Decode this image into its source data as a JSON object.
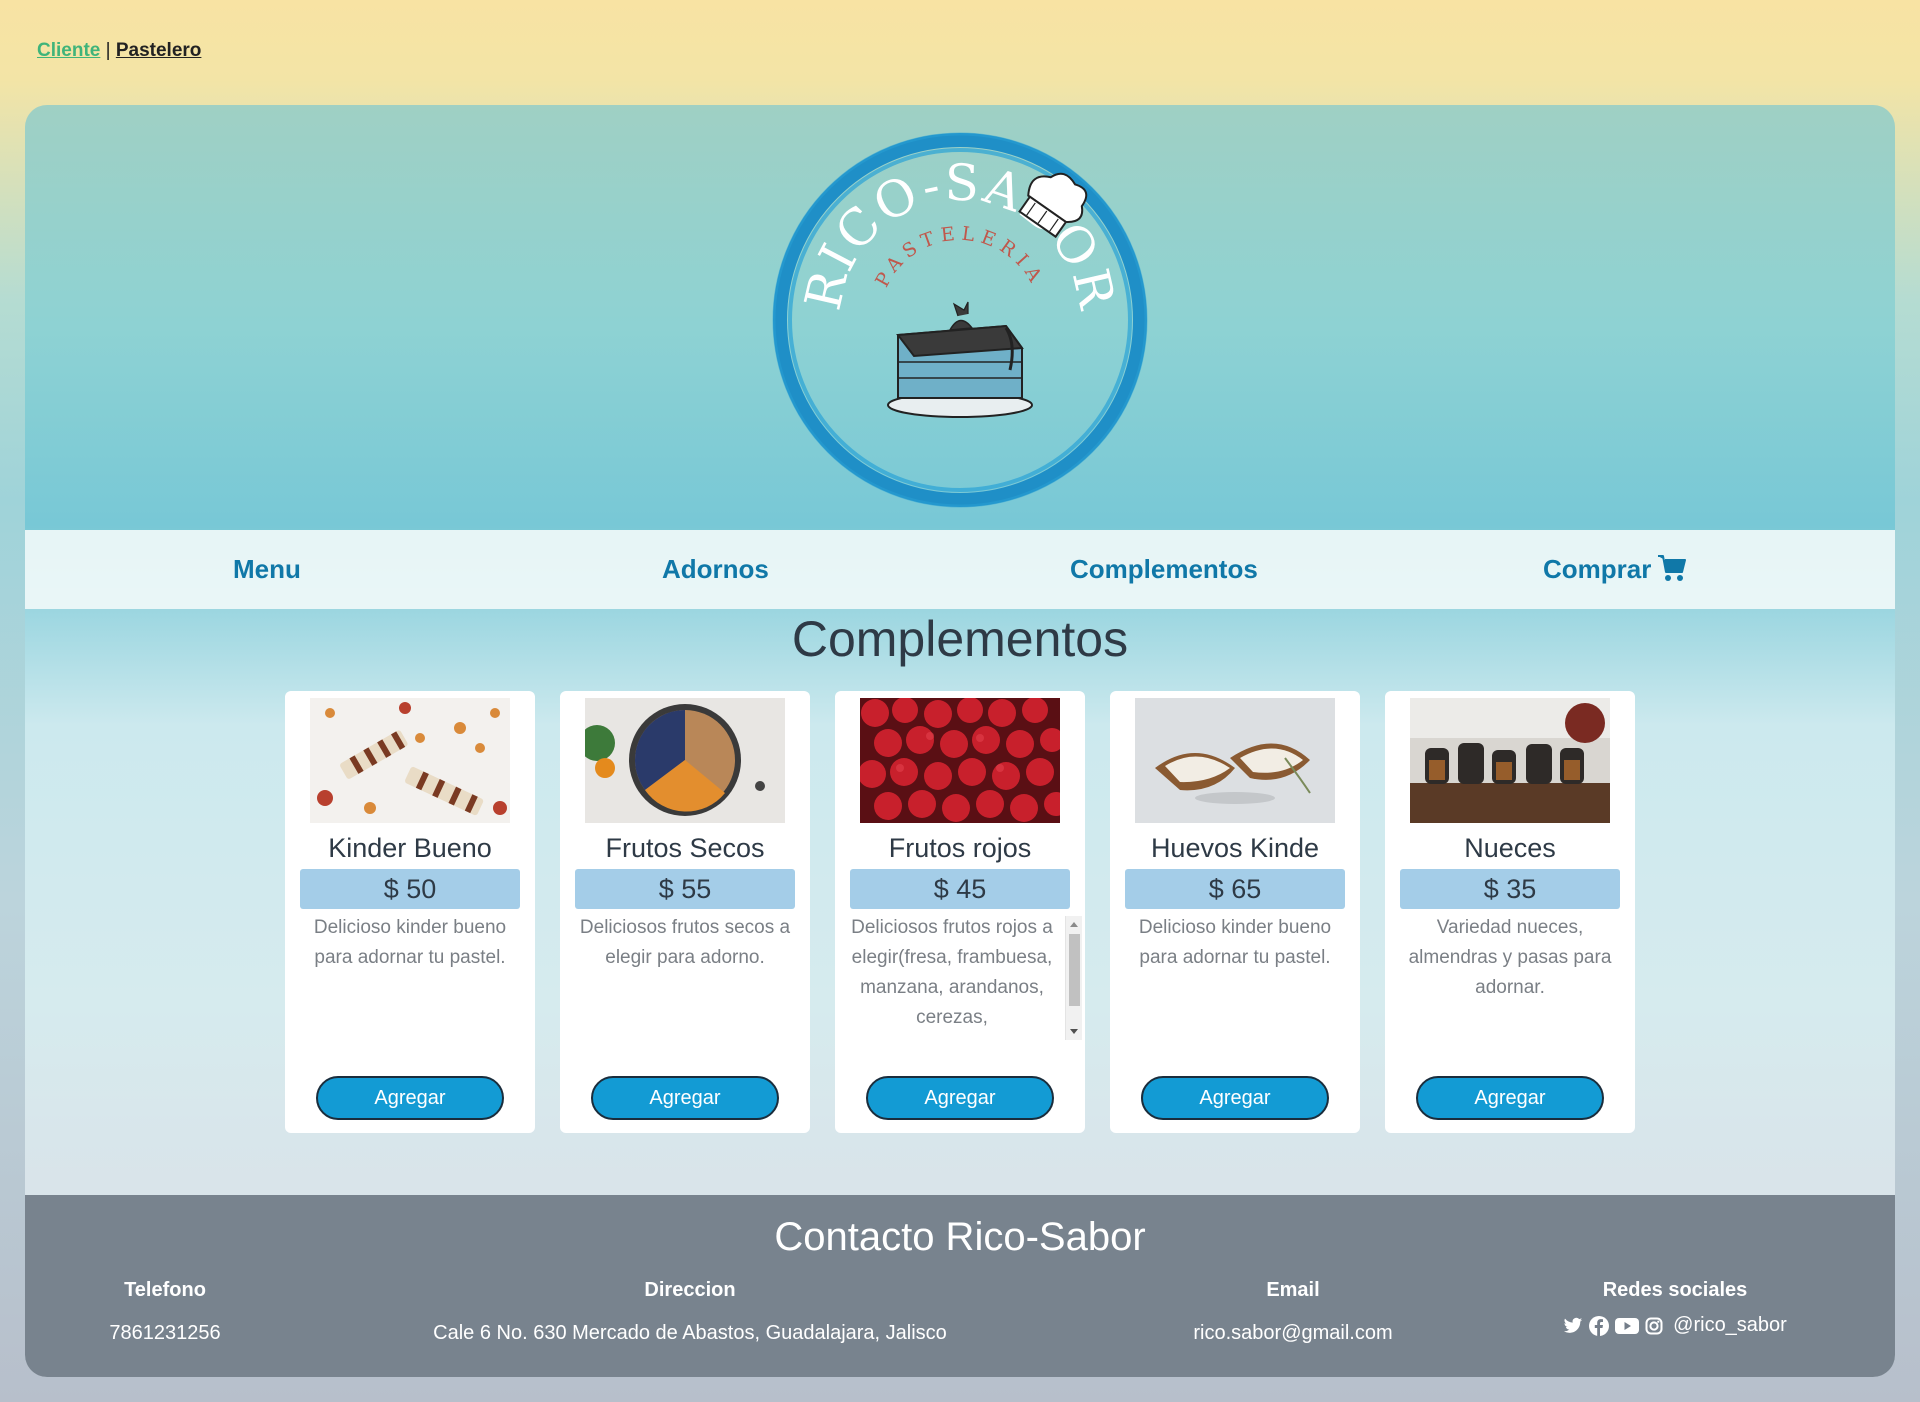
{
  "topbar": {
    "cliente": "Cliente",
    "separator": "|",
    "pastelero": "Pastelero"
  },
  "logo": {
    "brand": "RICO-SABOR",
    "subtitle": "PASTELERIA"
  },
  "nav": {
    "menu": "Menu",
    "adornos": "Adornos",
    "complementos": "Complementos",
    "comprar": "Comprar",
    "cart_icon": "shopping-cart-icon"
  },
  "section_title": "Complementos",
  "products": [
    {
      "name": "Kinder Bueno",
      "price": "$ 50",
      "description": "Delicioso kinder bueno para adornar tu pastel.",
      "button": "Agregar"
    },
    {
      "name": "Frutos Secos",
      "price": "$ 55",
      "description": "Deliciosos frutos secos a elegir para adorno.",
      "button": "Agregar"
    },
    {
      "name": "Frutos rojos",
      "price": "$ 45",
      "description": "Deliciosos frutos rojos a elegir(fresa, frambuesa, manzana, arandanos, cerezas,",
      "button": "Agregar"
    },
    {
      "name": "Huevos Kinde",
      "price": "$ 65",
      "description": "Delicioso kinder bueno para adornar tu pastel.",
      "button": "Agregar"
    },
    {
      "name": "Nueces",
      "price": "$ 35",
      "description": "Variedad nueces, almendras y pasas para adornar.",
      "button": "Agregar"
    }
  ],
  "footer": {
    "title": "Contacto Rico-Sabor",
    "telefono_label": "Telefono",
    "telefono": "7861231256",
    "direccion_label": "Direccion",
    "direccion": "Cale 6 No. 630 Mercado de Abastos, Guadalajara, Jalisco",
    "email_label": "Email",
    "email": "rico.sabor@gmail.com",
    "redes_label": "Redes sociales",
    "handle": "@rico_sabor",
    "social_icons": [
      "twitter-icon",
      "facebook-icon",
      "youtube-icon",
      "instagram-icon"
    ]
  },
  "colors": {
    "nav_link": "#1078a8",
    "button": "#139bd4",
    "price_bg": "#a4cde8",
    "footer_bg": "#737d89",
    "cliente_link": "#3fb47a"
  }
}
